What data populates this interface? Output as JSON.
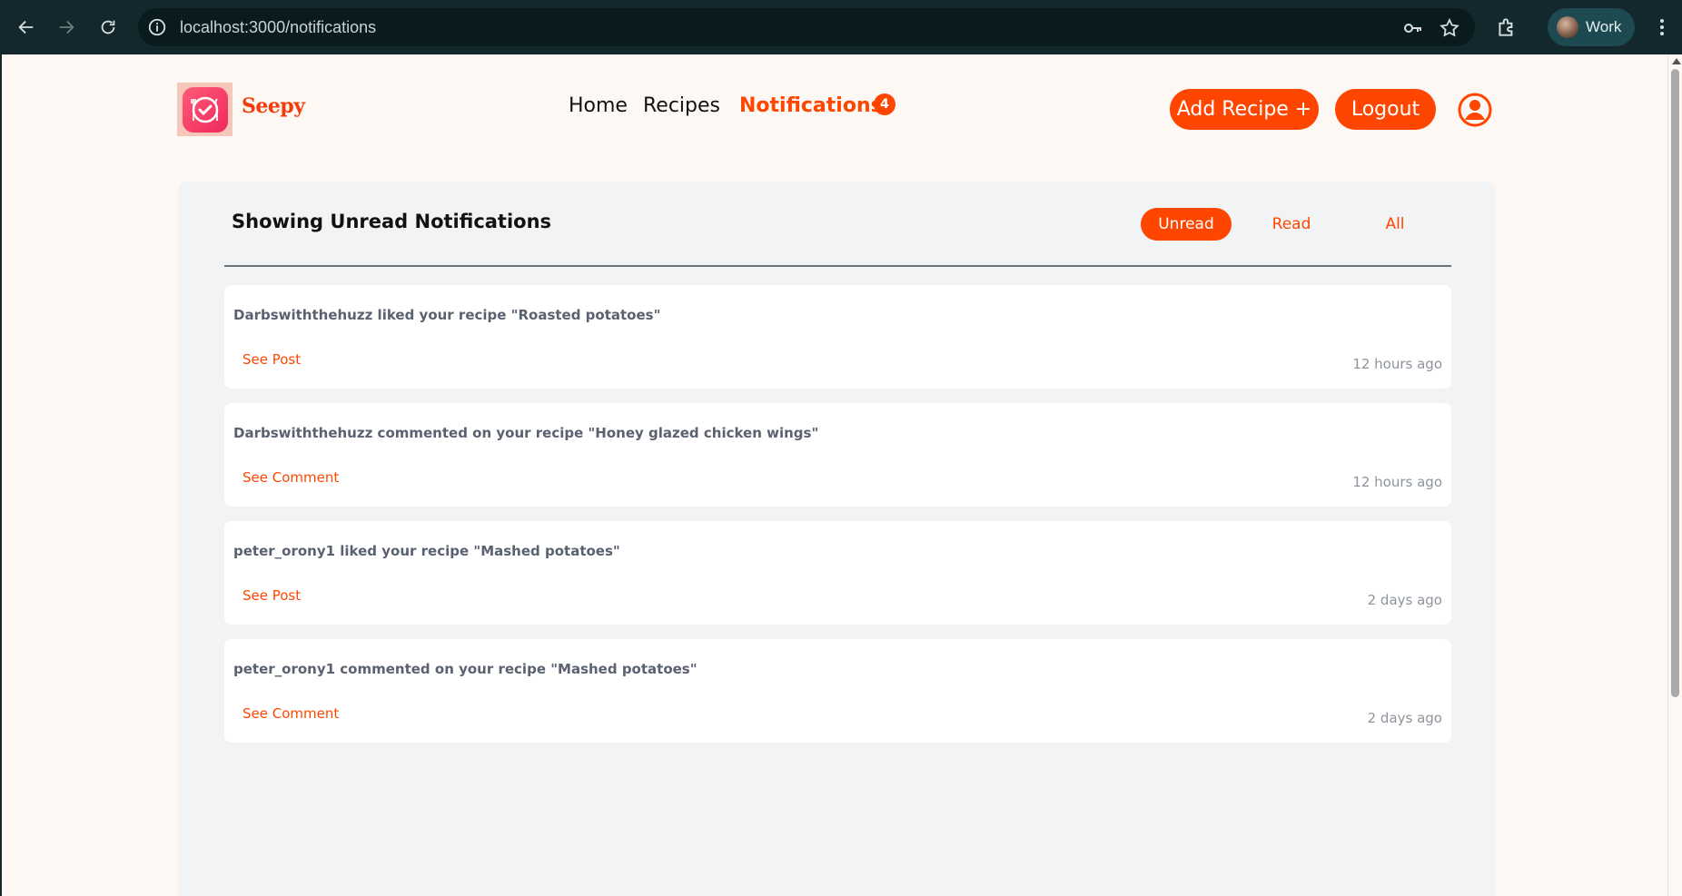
{
  "browser": {
    "url": "localhost:3000/notifications",
    "profile_label": "Work"
  },
  "header": {
    "brand_name": "Seepy",
    "nav": {
      "home": "Home",
      "recipes": "Recipes",
      "notifications": "Notifications",
      "notifications_count": "4"
    },
    "add_recipe_label": "Add Recipe +",
    "logout_label": "Logout"
  },
  "panel": {
    "title": "Showing Unread Notifications",
    "tabs": {
      "unread": "Unread",
      "read": "Read",
      "all": "All"
    },
    "active_tab": "Unread"
  },
  "notifications": [
    {
      "message": "Darbswiththehuzz liked your recipe \"Roasted potatoes\"",
      "action": "See Post",
      "time": "12 hours ago"
    },
    {
      "message": "Darbswiththehuzz commented on your recipe \"Honey glazed chicken wings\"",
      "action": "See Comment",
      "time": "12 hours ago"
    },
    {
      "message": "peter_orony1 liked your recipe \"Mashed potatoes\"",
      "action": "See Post",
      "time": "2 days ago"
    },
    {
      "message": "peter_orony1 commented on your recipe \"Mashed potatoes\"",
      "action": "See Comment",
      "time": "2 days ago"
    }
  ],
  "colors": {
    "accent": "#ff4600",
    "page_background": "#fdf8f4",
    "panel_background": "#f2f3f5",
    "chrome_background": "#12282c"
  },
  "icons": [
    "back-arrow-icon",
    "forward-arrow-icon",
    "reload-icon",
    "site-info-icon",
    "password-key-icon",
    "bookmark-star-icon",
    "extensions-puzzle-icon",
    "profile-avatar-icon",
    "more-menu-icon",
    "seepy-logo-icon",
    "user-account-icon"
  ]
}
